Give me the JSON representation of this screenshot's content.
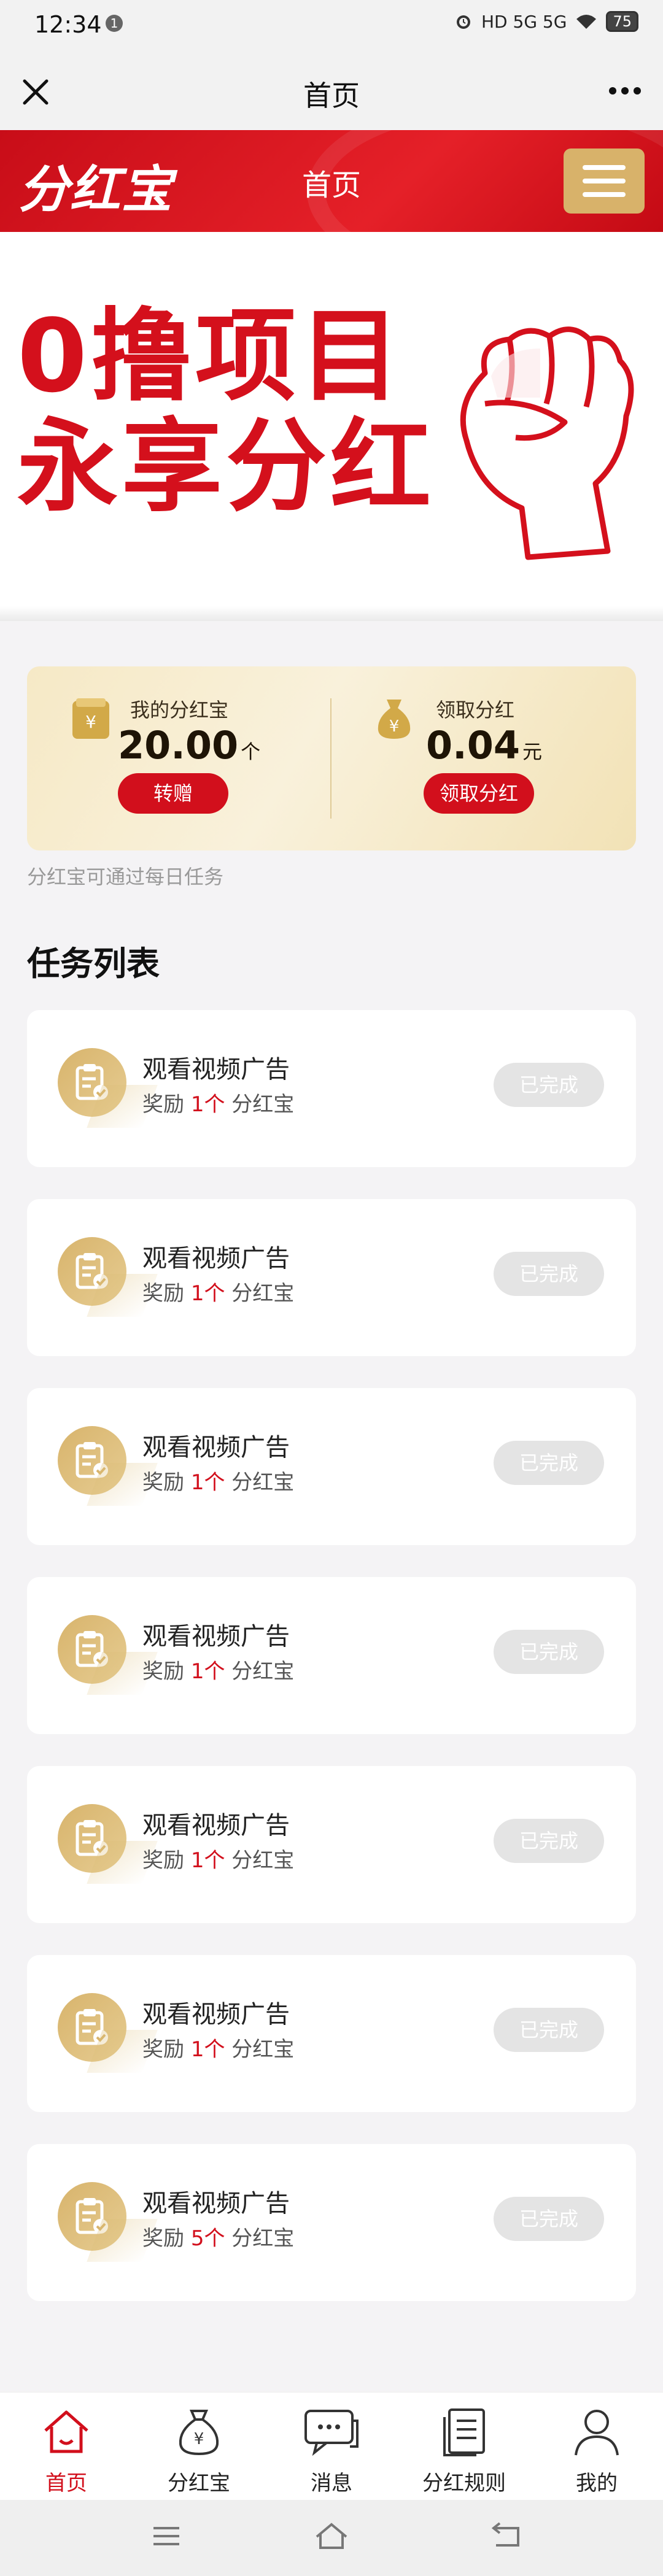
{
  "status_bar": {
    "time": "12:34",
    "notification_badge": "1",
    "indicators": "HD 5G 5G",
    "battery": "75"
  },
  "nav": {
    "title": "首页"
  },
  "header": {
    "logo_text": "分红宝",
    "title": "首页"
  },
  "banner": {
    "line1": "0撸项目",
    "line2": "永享分红"
  },
  "summary": {
    "left": {
      "label": "我的分红宝",
      "value": "20.00",
      "unit": "个",
      "button": "转赠"
    },
    "right": {
      "label": "领取分红",
      "value": "0.04",
      "unit": "元",
      "button": "领取分红"
    }
  },
  "tip": "分红宝可通过每日任务",
  "task_section_title": "任务列表",
  "tasks": [
    {
      "name": "观看视频广告",
      "reward_prefix": "奖励",
      "reward_num": "1个",
      "reward_suffix": "分红宝",
      "status": "已完成"
    },
    {
      "name": "观看视频广告",
      "reward_prefix": "奖励",
      "reward_num": "1个",
      "reward_suffix": "分红宝",
      "status": "已完成"
    },
    {
      "name": "观看视频广告",
      "reward_prefix": "奖励",
      "reward_num": "1个",
      "reward_suffix": "分红宝",
      "status": "已完成"
    },
    {
      "name": "观看视频广告",
      "reward_prefix": "奖励",
      "reward_num": "1个",
      "reward_suffix": "分红宝",
      "status": "已完成"
    },
    {
      "name": "观看视频广告",
      "reward_prefix": "奖励",
      "reward_num": "1个",
      "reward_suffix": "分红宝",
      "status": "已完成"
    },
    {
      "name": "观看视频广告",
      "reward_prefix": "奖励",
      "reward_num": "1个",
      "reward_suffix": "分红宝",
      "status": "已完成"
    },
    {
      "name": "观看视频广告",
      "reward_prefix": "奖励",
      "reward_num": "5个",
      "reward_suffix": "分红宝",
      "status": "已完成"
    }
  ],
  "tabbar": [
    {
      "label": "首页",
      "icon": "home-icon",
      "active": true
    },
    {
      "label": "分红宝",
      "icon": "money-bag-icon",
      "active": false
    },
    {
      "label": "消息",
      "icon": "message-icon",
      "active": false
    },
    {
      "label": "分红规则",
      "icon": "document-icon",
      "active": false
    },
    {
      "label": "我的",
      "icon": "user-icon",
      "active": false
    }
  ],
  "colors": {
    "brand_red": "#d20f1c",
    "gold": "#d8b26a",
    "done_gray": "#e4e4e4"
  }
}
